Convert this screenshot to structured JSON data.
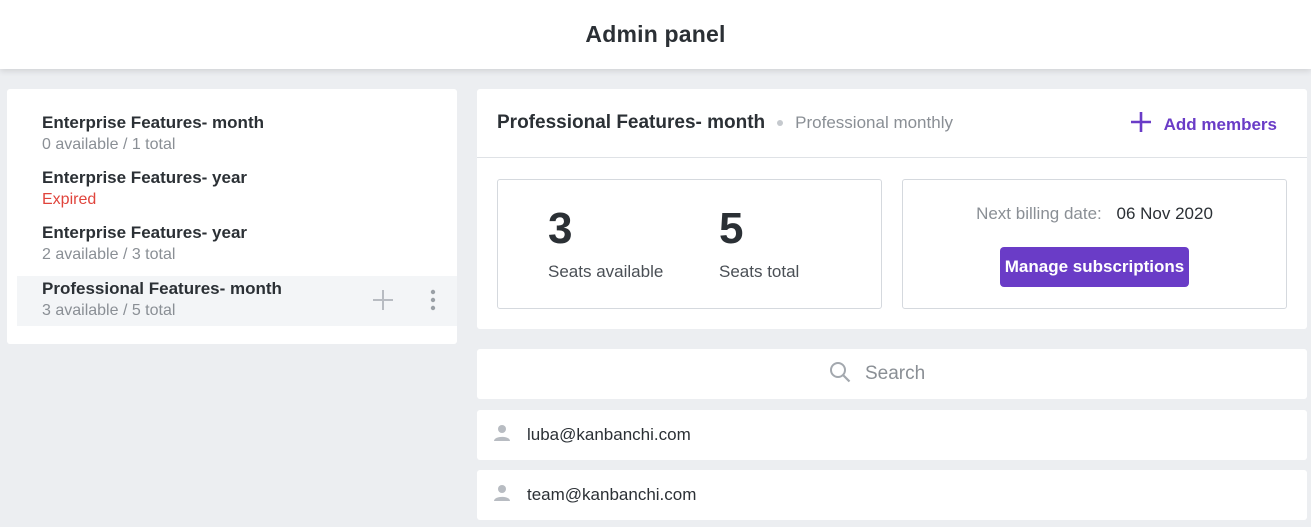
{
  "header": {
    "title": "Admin panel"
  },
  "sidebar": {
    "items": [
      {
        "name": "Enterprise Features- month",
        "meta": "0 available / 1 total",
        "expired": false
      },
      {
        "name": "Enterprise Features- year",
        "meta": "Expired",
        "expired": true
      },
      {
        "name": "Enterprise Features- year",
        "meta": "2 available / 3 total",
        "expired": false
      },
      {
        "name": "Professional Features- month",
        "meta": "3 available / 5 total",
        "expired": false,
        "selected": true
      }
    ]
  },
  "detail": {
    "title": "Professional Features- month",
    "plan": "Professional monthly",
    "add_members_label": "Add members",
    "seats_available": "3",
    "seats_available_label": "Seats available",
    "seats_total": "5",
    "seats_total_label": "Seats total",
    "billing_label": "Next billing date:",
    "billing_date": "06 Nov 2020",
    "manage_label": "Manage subscriptions"
  },
  "search": {
    "placeholder": "Search"
  },
  "members": [
    {
      "email": "luba@kanbanchi.com"
    },
    {
      "email": "team@kanbanchi.com"
    }
  ],
  "colors": {
    "accent": "#6a3cc7",
    "expired": "#e0443c",
    "background": "#eceef1"
  },
  "icons": [
    "plus-icon",
    "more-vertical-icon",
    "search-icon",
    "person-icon"
  ]
}
